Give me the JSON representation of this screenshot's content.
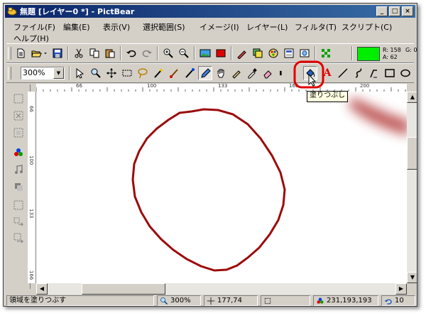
{
  "window": {
    "title": "無題 [レイヤー0 *] - PictBear",
    "buttons": {
      "minimize": "_",
      "maximize": "□",
      "close": "×"
    }
  },
  "menu": [
    "ファイル(F)",
    "編集(E)",
    "表示(V)",
    "選択範囲(S)",
    "イメージ(I)",
    "レイヤー(L)",
    "フィルタ(T)",
    "スクリプト(C)",
    "ヘルプ(H)"
  ],
  "toolbar1": {
    "current_color": "#00ee00",
    "coords": {
      "r": "R: 158",
      "g": "G: 0",
      "a": "A: 62"
    }
  },
  "toolbar2": {
    "zoom_select": "300%",
    "selected_tool": "fill-tool",
    "tooltip": "塗りつぶし",
    "text_tool_label": "A"
  },
  "ruler": {
    "h_ticks": [
      "66",
      "100",
      "133",
      "166",
      "200"
    ],
    "v_ticks": [
      "66",
      "100",
      "133",
      "166"
    ]
  },
  "status": {
    "message": "領域を塗りつぶす",
    "zoom": "300%",
    "cursor": "177,74",
    "color": "231,193,193",
    "brush_size": "10"
  },
  "colors": {
    "stroke": "#9b0a0a",
    "title_start": "#0a246a",
    "title_end": "#3a6ea5",
    "highlight_ring": "#e00000"
  }
}
